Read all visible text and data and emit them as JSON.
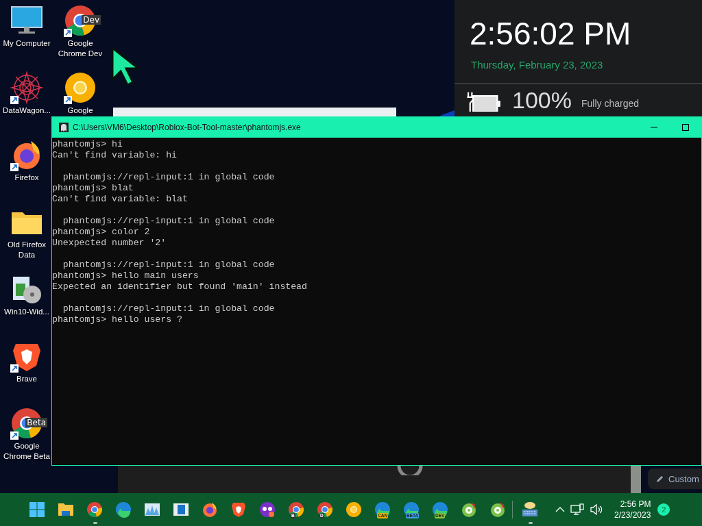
{
  "desktop_icons": [
    {
      "label": "My Computer",
      "kind": "monitor",
      "shortcut": false
    },
    {
      "label": "DataWagon...",
      "kind": "spiral",
      "shortcut": true
    },
    {
      "label": "Firefox",
      "kind": "firefox",
      "shortcut": true
    },
    {
      "label": "Old Firefox Data",
      "kind": "folder",
      "shortcut": false
    },
    {
      "label": "Win10-Wid...",
      "kind": "installer",
      "shortcut": false
    },
    {
      "label": "Brave",
      "kind": "brave",
      "shortcut": true
    },
    {
      "label": "Google Chrome Beta",
      "kind": "chrome",
      "badge": "Beta",
      "shortcut": true
    },
    {
      "label": "Google Chrome Dev",
      "kind": "chrome",
      "badge": "Dev",
      "shortcut": true
    },
    {
      "label": "Google",
      "kind": "canary",
      "shortcut": true
    }
  ],
  "clock_panel": {
    "time": "2:56:02 PM",
    "date": "Thursday, February 23, 2023",
    "battery_percent": "100%",
    "battery_status": "Fully charged"
  },
  "console": {
    "title": "C:\\Users\\VM6\\Desktop\\Roblox-Bot-Tool-master\\phantomjs.exe",
    "blocks": [
      [
        "phantomjs> hi",
        "Can't find variable: hi"
      ],
      [
        "  phantomjs://repl-input:1 in global code",
        "phantomjs> blat",
        "Can't find variable: blat"
      ],
      [
        "  phantomjs://repl-input:1 in global code",
        "phantomjs> color 2",
        "Unexpected number '2'"
      ],
      [
        "  phantomjs://repl-input:1 in global code",
        "phantomjs> hello main users",
        "Expected an identifier but found 'main' instead"
      ],
      [
        "  phantomjs://repl-input:1 in global code",
        "phantomjs> hello users ?"
      ]
    ]
  },
  "customize_button": {
    "label": "Custom"
  },
  "taskbar": {
    "apps": [
      {
        "kind": "start",
        "running": false
      },
      {
        "kind": "folder",
        "running": false
      },
      {
        "kind": "chrome",
        "running": true
      },
      {
        "kind": "edge",
        "running": false
      },
      {
        "kind": "chart",
        "running": false
      },
      {
        "kind": "panel",
        "running": false
      },
      {
        "kind": "firefox",
        "running": false
      },
      {
        "kind": "brave",
        "running": false
      },
      {
        "kind": "mask",
        "running": false
      },
      {
        "kind": "chrome",
        "badge": "B",
        "running": false
      },
      {
        "kind": "chrome",
        "badge": "D",
        "running": false
      },
      {
        "kind": "canary",
        "running": false
      },
      {
        "kind": "edge",
        "badge": "CAN",
        "running": false
      },
      {
        "kind": "edge",
        "badge": "BETA",
        "running": false
      },
      {
        "kind": "edge",
        "badge": "DEV",
        "running": false
      },
      {
        "kind": "disc",
        "running": false
      },
      {
        "kind": "disc",
        "running": false
      },
      {
        "kind": "keyboard",
        "running": true
      }
    ],
    "time": "2:56 PM",
    "date": "2/23/2023",
    "notification_count": "2"
  }
}
